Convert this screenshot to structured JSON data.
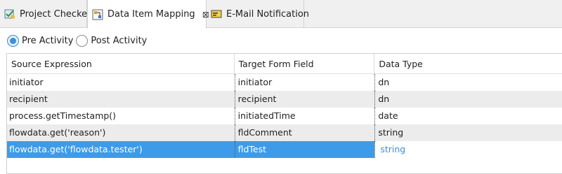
{
  "tabs": [
    {
      "label": "Project Checker",
      "icon": "project-checker-icon"
    },
    {
      "label": "Data Item Mapping",
      "icon": "data-mapping-icon",
      "close": "⊠"
    },
    {
      "label": "E-Mail Notification",
      "icon": "email-notification-icon"
    }
  ],
  "activity": {
    "pre_label": "Pre Activity",
    "post_label": "Post Activity",
    "selected": "Pre Activity"
  },
  "table": {
    "headers": [
      "Source Expression",
      "Target Form Field",
      "Data Type"
    ],
    "rows": [
      [
        "initiator",
        "initiator",
        "dn"
      ],
      [
        "recipient",
        "recipient",
        "dn"
      ],
      [
        "process.getTimestamp()",
        "initiatedTime",
        "date"
      ],
      [
        "flowdata.get('reason')",
        "fldComment",
        "string"
      ],
      [
        "flowdata.get('flowdata.tester')",
        "fldTest",
        "string"
      ]
    ],
    "selected_row": 4
  },
  "colors": {
    "selection": "#3d9be9",
    "radio_accent": "#3e8fd6",
    "row_alt": "#ececec"
  }
}
